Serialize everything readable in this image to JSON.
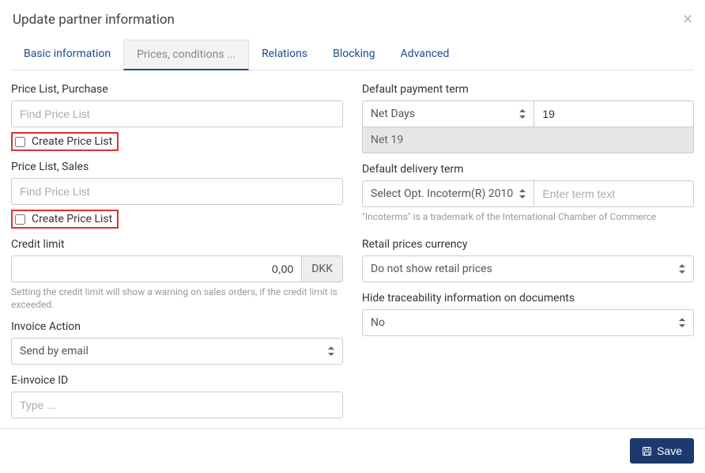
{
  "header": {
    "title": "Update partner information"
  },
  "tabs": {
    "basic": "Basic information",
    "prices": "Prices, conditions ...",
    "relations": "Relations",
    "blocking": "Blocking",
    "advanced": "Advanced"
  },
  "left": {
    "price_list_purchase": {
      "label": "Price List, Purchase",
      "placeholder": "Find Price List",
      "create": "Create Price List"
    },
    "price_list_sales": {
      "label": "Price List, Sales",
      "placeholder": "Find Price List",
      "create": "Create Price List"
    },
    "credit_limit": {
      "label": "Credit limit",
      "value": "0,00",
      "currency": "DKK",
      "help": "Setting the credit limit will show a warning on sales orders, if the credit limit is exceeded."
    },
    "invoice_action": {
      "label": "Invoice Action",
      "value": "Send by email"
    },
    "einvoice": {
      "label": "E-invoice ID",
      "placeholder": "Type ..."
    }
  },
  "right": {
    "default_payment": {
      "label": "Default payment term",
      "type": "Net Days",
      "value": "19",
      "result": "Net 19"
    },
    "default_delivery": {
      "label": "Default delivery term",
      "select": "Select Opt. Incoterm(R) 2010",
      "placeholder": "Enter term text",
      "help": "\"Incoterms\" is a trademark of the International Chamber of Commerce"
    },
    "retail_currency": {
      "label": "Retail prices currency",
      "value": "Do not show retail prices"
    },
    "hide_trace": {
      "label": "Hide traceability information on documents",
      "value": "No"
    }
  },
  "footer": {
    "save": "Save"
  }
}
